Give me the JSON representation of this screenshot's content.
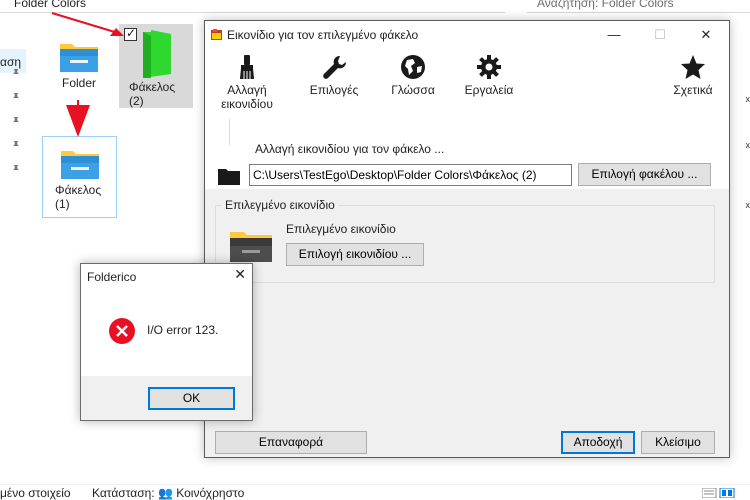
{
  "explorer": {
    "address": "Folder Colors",
    "search_placeholder": "Αναζήτηση: Folder Colors",
    "nav_partial": "αση",
    "status_left": "μένο στοιχείο",
    "status_right": "Κατάσταση: 👥 Κοινόχρηστο",
    "items": [
      {
        "label": "Folder"
      },
      {
        "label": "Φάκελος (2)"
      },
      {
        "label": "Φάκελος (1)"
      }
    ],
    "colors": {
      "folder_green": "#2ed82e",
      "folder_blue": "#3b8fd1",
      "arrow_red": "#e81123"
    }
  },
  "dialog": {
    "title": "Εικονίδιο  για τον επιλεγμένο φάκελο",
    "tools": [
      {
        "label": "Αλλαγή εικονιδίου",
        "icon": "brush-icon"
      },
      {
        "label": "Επιλογές",
        "icon": "wrench-icon"
      },
      {
        "label": "Γλώσσα",
        "icon": "globe-icon"
      },
      {
        "label": "Εργαλεία",
        "icon": "gear-icon"
      },
      {
        "label": "Σχετικά",
        "icon": "star-icon"
      }
    ],
    "change_section_title": "Αλλαγή εικονιδίου για τον φάκελο ...",
    "path_value": "C:\\Users\\TestEgo\\Desktop\\Folder Colors\\Φάκελος (2)",
    "choose_folder_btn": "Επιλογή φακέλου ...",
    "group_title": "Επιλεγμένο εικονίδιο",
    "selected_icon_label": "Επιλεγμένο εικονίδιο",
    "choose_icon_btn": "Επιλογή εικονιδίου ...",
    "reset_btn": "Επαναφορά",
    "accept_btn": "Αποδοχή",
    "close_btn": "Κλείσιμο"
  },
  "error_dialog": {
    "title": "Folderico",
    "message": "I/O error 123.",
    "ok_btn": "OK"
  }
}
